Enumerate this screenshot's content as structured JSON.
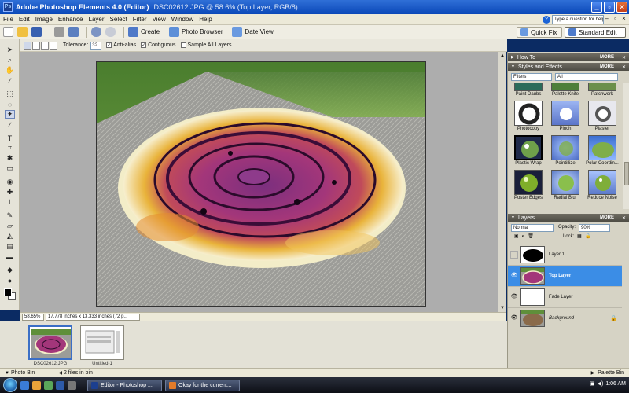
{
  "window": {
    "title": "Adobe Photoshop Elements 4.0 (Editor)",
    "doc_title": "DSC02612.JPG @ 58.6% (Top Layer, RGB/8)"
  },
  "menu": [
    "File",
    "Edit",
    "Image",
    "Enhance",
    "Layer",
    "Select",
    "Filter",
    "View",
    "Window",
    "Help"
  ],
  "help_placeholder": "Type a question for help",
  "shortcuts": {
    "create": "Create",
    "photo_browser": "Photo Browser",
    "date_view": "Date View",
    "quick_fix": "Quick Fix",
    "standard_edit": "Standard Edit"
  },
  "options": {
    "tolerance_label": "Tolerance:",
    "tolerance_value": "32",
    "anti_alias": "Anti-alias",
    "contiguous": "Contiguous",
    "sample_all": "Sample All Layers"
  },
  "status": {
    "zoom": "58.65%",
    "info": "17.778 inches x 13.333 inches (72 p..."
  },
  "photo_bin": {
    "items": [
      {
        "label": "DSC02612.JPG"
      },
      {
        "label": "Untitled-1"
      }
    ],
    "bin_label": "Photo Bin",
    "count_text": "2 files in bin",
    "palette_bin_label": "Palette Bin"
  },
  "palettes": {
    "how_to": "How To",
    "styles_effects": "Styles and Effects",
    "more": "MORE",
    "category": "Filters",
    "subcategory": "All",
    "effects": [
      {
        "label": "Paint Daubs"
      },
      {
        "label": "Palette Knife"
      },
      {
        "label": "Patchwork"
      },
      {
        "label": "Photocopy"
      },
      {
        "label": "Pinch"
      },
      {
        "label": "Plaster"
      },
      {
        "label": "Plastic Wrap"
      },
      {
        "label": "Pointillize"
      },
      {
        "label": "Polar Coordin..."
      },
      {
        "label": "Poster Edges"
      },
      {
        "label": "Radial Blur"
      },
      {
        "label": "Reduce Noise"
      }
    ],
    "layers_title": "Layers",
    "blend_mode": "Normal",
    "opacity_label": "Opacity:",
    "opacity_value": "90%",
    "lock_label": "Lock:",
    "layers": [
      {
        "name": "Layer 1"
      },
      {
        "name": "Top Layer"
      },
      {
        "name": "Fade Layer"
      },
      {
        "name": "Background"
      }
    ]
  },
  "taskbar": {
    "tasks": [
      "Editor - Photoshop ...",
      "Okay for the current..."
    ],
    "clock": "1:06 AM"
  },
  "colors": {
    "titlebar": "#0a48b8",
    "active_layer": "#3b8de6",
    "palette_header": "#4e4c44"
  }
}
